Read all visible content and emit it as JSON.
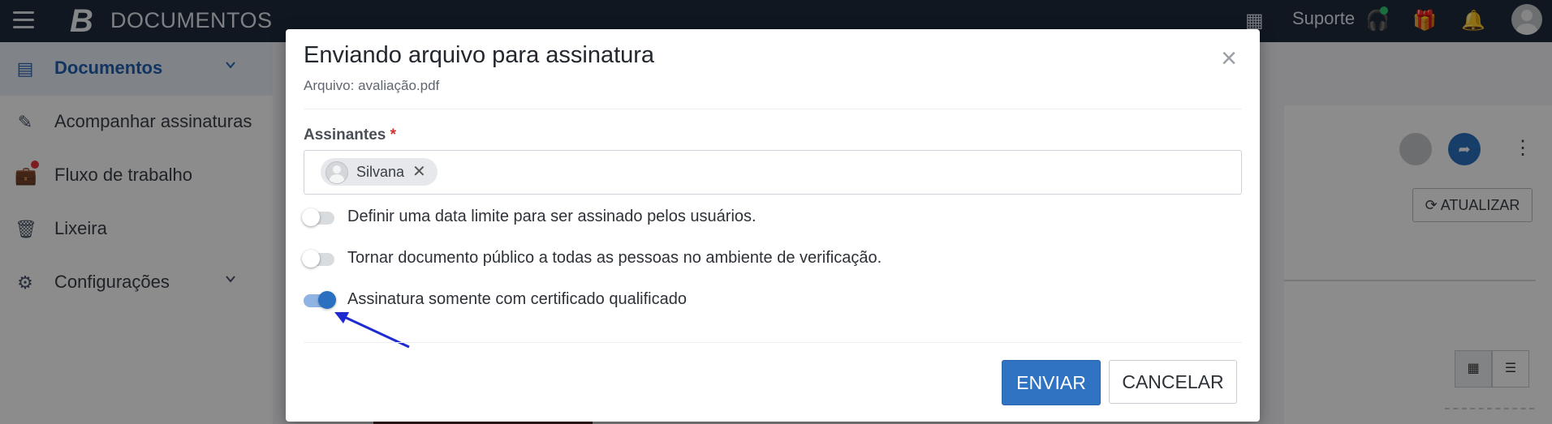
{
  "app": {
    "brand_letter": "B",
    "brand_name": "DOCUMENTOS",
    "support_label": "Suporte"
  },
  "sidebar": {
    "items": [
      {
        "label": "Documentos",
        "icon": "documents-icon",
        "active": true
      },
      {
        "label": "Acompanhar assinaturas",
        "icon": "signature-pen-icon"
      },
      {
        "label": "Fluxo de trabalho",
        "icon": "briefcase-icon"
      },
      {
        "label": "Lixeira",
        "icon": "trash-icon"
      },
      {
        "label": "Configurações",
        "icon": "settings-icon"
      }
    ]
  },
  "background": {
    "refresh_label": "ATUALIZAR"
  },
  "modal": {
    "title": "Enviando arquivo para assinatura",
    "subtitle": "Arquivo: avaliação.pdf",
    "signers_label": "Assinantes",
    "required_mark": "*",
    "signers": [
      {
        "name": "Silvana"
      }
    ],
    "options": [
      {
        "label": "Definir uma data limite para ser assinado pelos usuários.",
        "enabled": false
      },
      {
        "label": "Tornar documento público a todas as pessoas no ambiente de verificação.",
        "enabled": false
      },
      {
        "label": "Assinatura somente com certificado qualificado",
        "enabled": true
      }
    ],
    "submit_label": "ENVIAR",
    "cancel_label": "CANCELAR"
  },
  "colors": {
    "primary": "#2f73c2",
    "topbar": "#1e2a3d",
    "annotation_arrow": "#1d2bd0"
  }
}
